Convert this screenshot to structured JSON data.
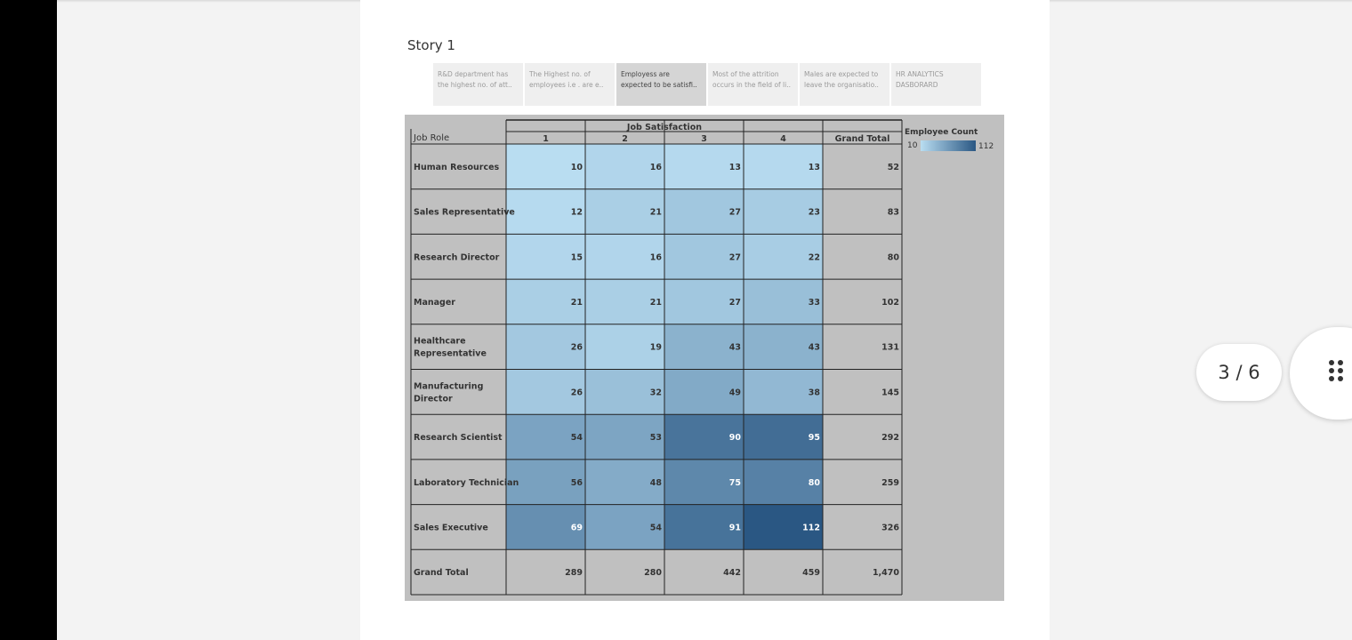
{
  "story": {
    "title": "Story 1",
    "points": [
      {
        "text": "R&D department has the highest no. of att..",
        "active": false
      },
      {
        "text": "The Highest no. of employees i.e . are e..",
        "active": false
      },
      {
        "text": "Employess are expected to be satisfi..",
        "active": true
      },
      {
        "text": "Most of the attrition occurs in the field of li..",
        "active": false
      },
      {
        "text": "Males are expected to leave the organisatio..",
        "active": false
      },
      {
        "text": "HR ANALYTICS DASBORARD",
        "active": false
      }
    ]
  },
  "pager": {
    "label": "3 / 6",
    "grid_icon": "grid-dots-icon"
  },
  "chart_data": {
    "type": "heatmap",
    "row_header": "Job Role",
    "column_group": "Job Satisfaction",
    "columns": [
      "1",
      "2",
      "3",
      "4",
      "Grand Total"
    ],
    "rows": [
      {
        "label": "Human Resources",
        "values": [
          10,
          16,
          13,
          13
        ],
        "total": "52"
      },
      {
        "label": "Sales Representative",
        "values": [
          12,
          21,
          27,
          23
        ],
        "total": "83"
      },
      {
        "label": "Research Director",
        "values": [
          15,
          16,
          27,
          22
        ],
        "total": "80"
      },
      {
        "label": "Manager",
        "values": [
          21,
          21,
          27,
          33
        ],
        "total": "102"
      },
      {
        "label": "Healthcare Representative",
        "values": [
          26,
          19,
          43,
          43
        ],
        "total": "131"
      },
      {
        "label": "Manufacturing Director",
        "values": [
          26,
          32,
          49,
          38
        ],
        "total": "145"
      },
      {
        "label": "Research Scientist",
        "values": [
          54,
          53,
          90,
          95
        ],
        "total": "292"
      },
      {
        "label": "Laboratory Technician",
        "values": [
          56,
          48,
          75,
          80
        ],
        "total": "259"
      },
      {
        "label": "Sales Executive",
        "values": [
          69,
          54,
          91,
          112
        ],
        "total": "326"
      }
    ],
    "grand_total_row": {
      "label": "Grand Total",
      "values": [
        "289",
        "280",
        "442",
        "459"
      ],
      "total": "1,470"
    },
    "legend": {
      "title": "Employee Count",
      "min": 10,
      "max": 112,
      "min_label": "10",
      "max_label": "112"
    },
    "colors": {
      "low": "#b9ddf1",
      "high": "#2a5783",
      "background": "#c0c0c0",
      "total_cell": "#c0c0c0"
    }
  }
}
